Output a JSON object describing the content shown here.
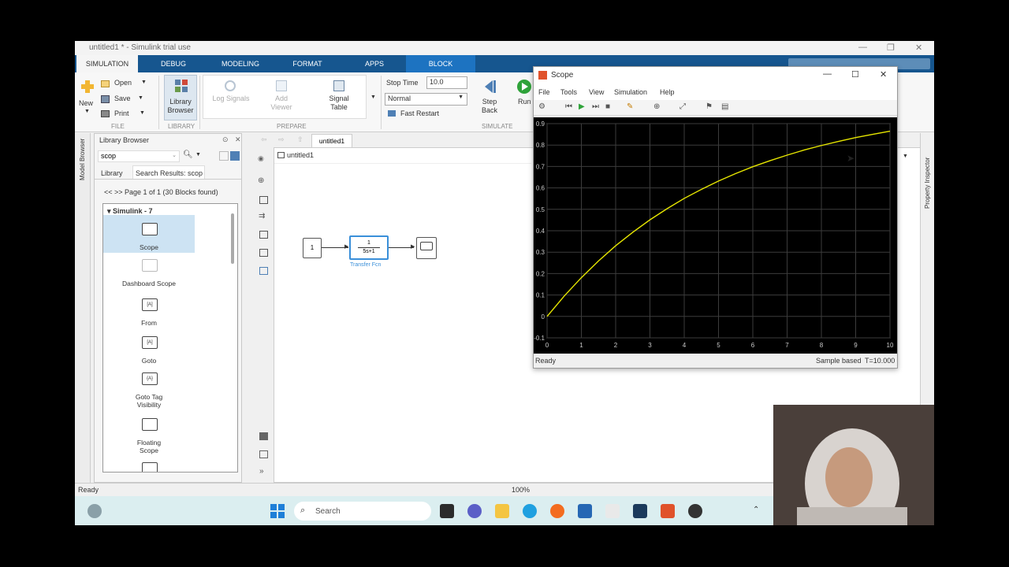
{
  "window": {
    "title": "untitled1 * - Simulink trial use"
  },
  "ribbon_tabs": [
    "SIMULATION",
    "DEBUG",
    "MODELING",
    "FORMAT",
    "APPS",
    "BLOCK"
  ],
  "ribbon": {
    "new": "New",
    "open": "Open",
    "save": "Save",
    "print": "Print",
    "file_group": "FILE",
    "library_browser": "Library Browser",
    "library_group": "LIBRARY",
    "log_signals": "Log Signals",
    "add_viewer": "Add Viewer",
    "signal_table": "Signal Table",
    "prepare_group": "PREPARE",
    "stop_time_label": "Stop Time",
    "stop_time_value": "10.0",
    "mode_value": "Normal",
    "fast_restart": "Fast Restart",
    "step_back": "Step Back",
    "run": "Run",
    "simulate_group": "SIMULATE"
  },
  "left_strip": {
    "model_browser": "Model Browser"
  },
  "right_strip": {
    "property_inspector": "Property Inspector"
  },
  "library_browser": {
    "title": "Library Browser",
    "search_value": "scop",
    "tabs": [
      "Library",
      "Search Results: scop"
    ],
    "page_info": "<< >> Page 1 of 1 (30 Blocks found)",
    "tree_header": "Simulink - 7",
    "items": [
      "Scope",
      "Dashboard Scope",
      "From",
      "Goto",
      "Goto Tag Visibility",
      "Floating Scope"
    ],
    "icons": {
      "from": "[A]",
      "goto": "[A]",
      "goto_tag": "{A}"
    }
  },
  "canvas": {
    "tab": "untitled1",
    "address": "untitled1",
    "constant_value": "1",
    "tf_numerator": "1",
    "tf_denominator": "5s+1",
    "tf_label": "Transfer Fcn"
  },
  "status": {
    "left": "Ready",
    "zoom": "100%"
  },
  "taskbar": {
    "search_placeholder": "Search"
  },
  "scope": {
    "title": "Scope",
    "menu": [
      "File",
      "Tools",
      "View",
      "Simulation",
      "Help"
    ],
    "status_left": "Ready",
    "status_mode": "Sample based",
    "status_time": "T=10.000",
    "colors": {
      "background": "#000000",
      "grid": "#3c3c3c",
      "trace": "#e6e600",
      "tick": "#cccccc"
    }
  },
  "chart_data": {
    "type": "line",
    "title": "",
    "xlabel": "",
    "ylabel": "",
    "xlim": [
      0,
      10
    ],
    "ylim": [
      -0.1,
      0.9
    ],
    "xticks": [
      0,
      1,
      2,
      3,
      4,
      5,
      6,
      7,
      8,
      9,
      10
    ],
    "yticks": [
      -0.1,
      0,
      0.1,
      0.2,
      0.3,
      0.4,
      0.5,
      0.6,
      0.7,
      0.8,
      0.9
    ],
    "grid": true,
    "x": [
      0,
      0.5,
      1,
      1.5,
      2,
      2.5,
      3,
      3.5,
      4,
      4.5,
      5,
      5.5,
      6,
      6.5,
      7,
      7.5,
      8,
      8.5,
      9,
      9.5,
      10
    ],
    "series": [
      {
        "values": [
          0,
          0.095,
          0.181,
          0.259,
          0.33,
          0.393,
          0.451,
          0.503,
          0.551,
          0.593,
          0.632,
          0.667,
          0.699,
          0.727,
          0.753,
          0.777,
          0.798,
          0.817,
          0.835,
          0.85,
          0.865
        ]
      }
    ]
  }
}
